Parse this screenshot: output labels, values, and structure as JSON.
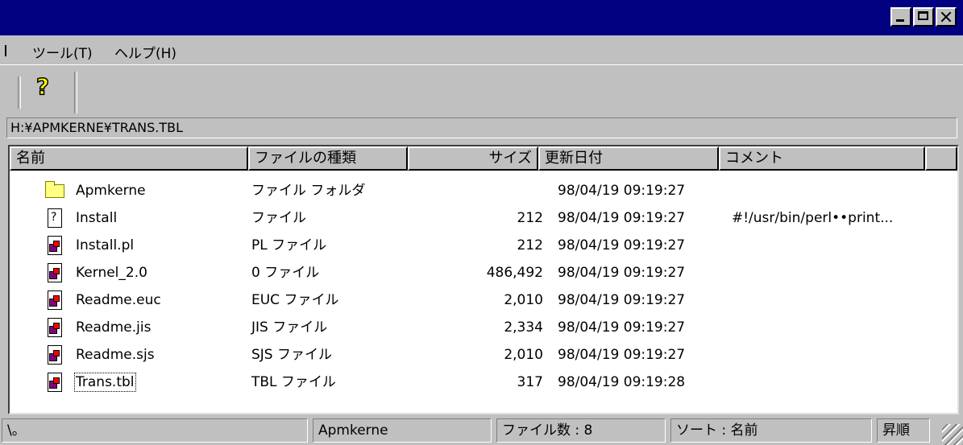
{
  "menu": {
    "tools": "ツール(T)",
    "help": "ヘルプ(H)"
  },
  "toolbar": {
    "help_glyph": "?"
  },
  "path": "H:¥APMKERNE¥TRANS.TBL",
  "columns": {
    "name": "名前",
    "type": "ファイルの種類",
    "size": "サイズ",
    "date": "更新日付",
    "comment": "コメント"
  },
  "files": [
    {
      "icon": "folder-icon",
      "name": "Apmkerne",
      "type": "ファイル フォルダ",
      "size": "",
      "date": "98/04/19 09:19:27",
      "comment": ""
    },
    {
      "icon": "unknown-file-icon",
      "name": "Install",
      "type": "ファイル",
      "size": "212",
      "date": "98/04/19 09:19:27",
      "comment": "#!/usr/bin/perl••print..."
    },
    {
      "icon": "app-file-icon",
      "name": "Install.pl",
      "type": "PL ファイル",
      "size": "212",
      "date": "98/04/19 09:19:27",
      "comment": ""
    },
    {
      "icon": "app-file-icon",
      "name": "Kernel_2.0",
      "type": "0 ファイル",
      "size": "486,492",
      "date": "98/04/19 09:19:27",
      "comment": ""
    },
    {
      "icon": "app-file-icon",
      "name": "Readme.euc",
      "type": "EUC ファイル",
      "size": "2,010",
      "date": "98/04/19 09:19:27",
      "comment": ""
    },
    {
      "icon": "app-file-icon",
      "name": "Readme.jis",
      "type": "JIS ファイル",
      "size": "2,334",
      "date": "98/04/19 09:19:27",
      "comment": ""
    },
    {
      "icon": "app-file-icon",
      "name": "Readme.sjs",
      "type": "SJS ファイル",
      "size": "2,010",
      "date": "98/04/19 09:19:27",
      "comment": ""
    },
    {
      "icon": "app-file-icon",
      "name": "Trans.tbl",
      "type": "TBL ファイル",
      "size": "317",
      "date": "98/04/19 09:19:28",
      "comment": ""
    }
  ],
  "status": {
    "left": "\\。",
    "folder": "Apmkerne",
    "count": "ファイル数 : 8",
    "sort": "ソート : 名前",
    "order": "昇順"
  }
}
